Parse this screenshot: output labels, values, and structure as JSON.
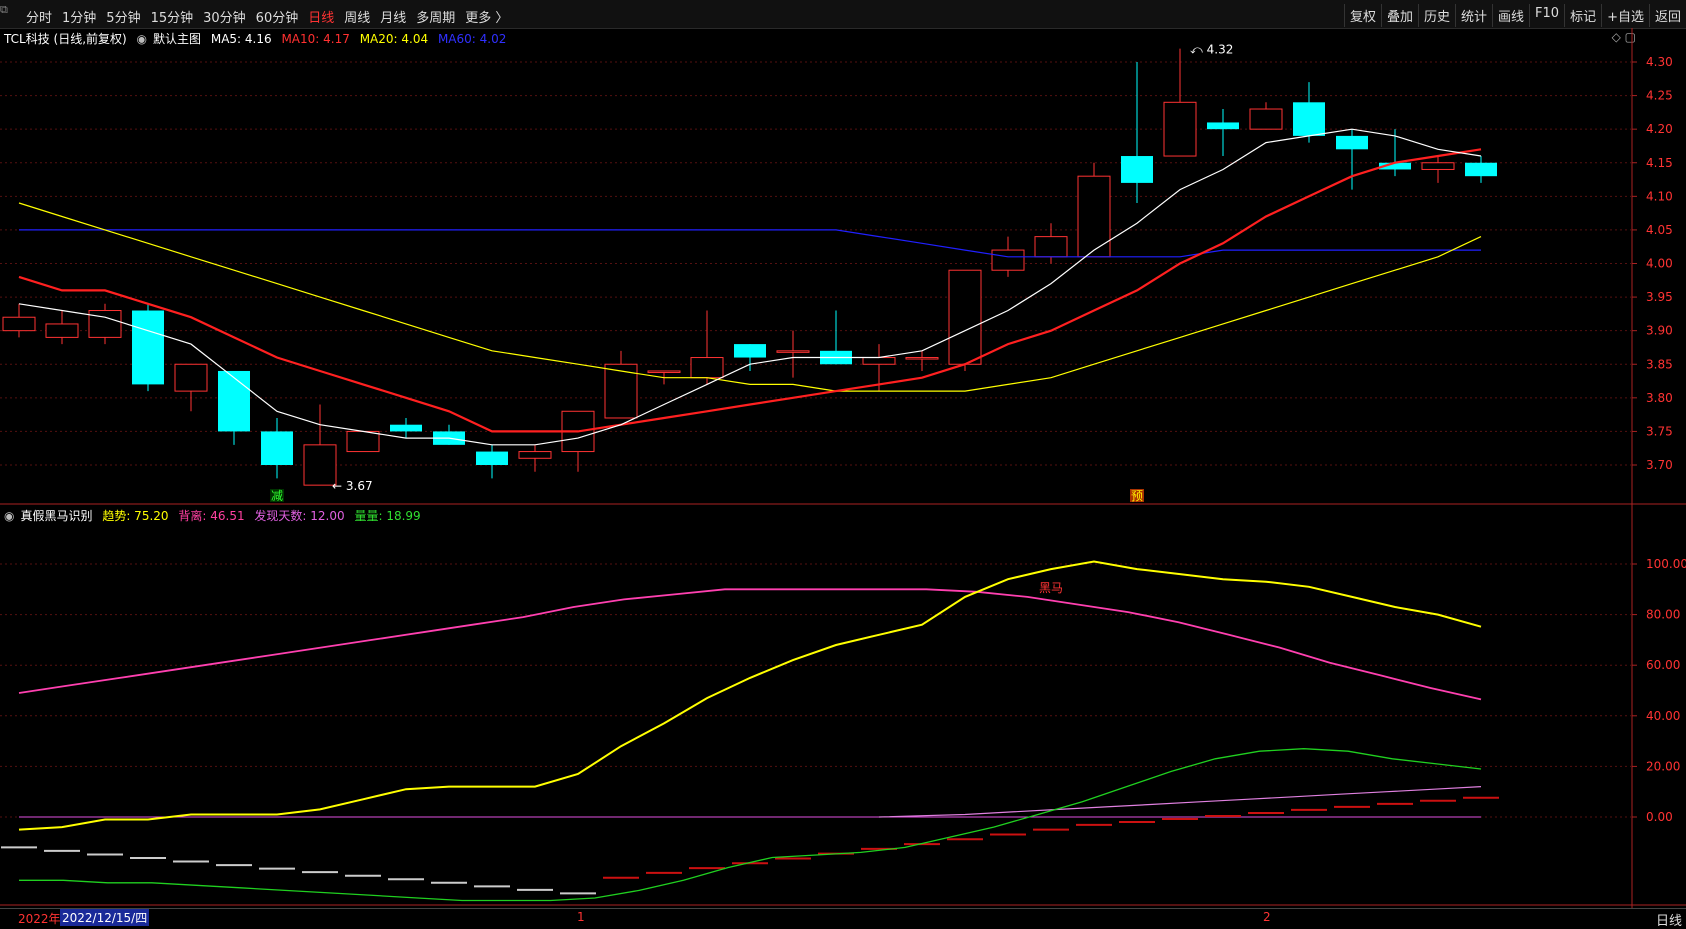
{
  "toolbar": {
    "periods": [
      "分时",
      "1分钟",
      "5分钟",
      "15分钟",
      "30分钟",
      "60分钟",
      "日线",
      "周线",
      "月线",
      "多周期",
      "更多 〉"
    ],
    "active_period": "日线",
    "right_tools": [
      "复权",
      "叠加",
      "历史",
      "统计",
      "画线",
      "F10",
      "标记",
      "+自选",
      "返回"
    ]
  },
  "main_panel": {
    "title": "TCL科技 (日线,前复权)",
    "indicator_name": "默认主图",
    "ma5_label": "MA5: 4.16",
    "ma10_label": "MA10: 4.17",
    "ma20_label": "MA20: 4.04",
    "ma60_label": "MA60: 4.02",
    "high_label": "4.32",
    "low_label": "3.67",
    "signal_jian": "减",
    "signal_yu": "预",
    "y_ticks": [
      "4.30",
      "4.25",
      "4.20",
      "4.15",
      "4.10",
      "4.05",
      "4.00",
      "3.95",
      "3.90",
      "3.85",
      "3.80",
      "3.75",
      "3.70"
    ],
    "colors": {
      "up": "#ff3333",
      "down": "#00ffff",
      "ma5": "#ffffff",
      "ma10": "#ff2020",
      "ma20": "#ffff00",
      "ma60": "#2020ff"
    }
  },
  "sub_panel": {
    "indicator_name": "真假黑马识别",
    "trend_label": "趋势: 75.20",
    "deviation_label": "背离: 46.51",
    "days_label": "发现天数: 12.00",
    "volume_label": "量量: 18.99",
    "heima_label": "黑马",
    "y_ticks": [
      "100.00",
      "80.00",
      "60.00",
      "40.00",
      "20.00",
      "0.00"
    ]
  },
  "chart_data": {
    "type": "candlestick",
    "candles": [
      {
        "o": 3.9,
        "h": 3.94,
        "l": 3.89,
        "c": 3.92
      },
      {
        "o": 3.89,
        "h": 3.93,
        "l": 3.88,
        "c": 3.91
      },
      {
        "o": 3.89,
        "h": 3.94,
        "l": 3.88,
        "c": 3.93
      },
      {
        "o": 3.93,
        "h": 3.94,
        "l": 3.81,
        "c": 3.82
      },
      {
        "o": 3.81,
        "h": 3.85,
        "l": 3.78,
        "c": 3.85
      },
      {
        "o": 3.84,
        "h": 3.84,
        "l": 3.73,
        "c": 3.75
      },
      {
        "o": 3.75,
        "h": 3.77,
        "l": 3.68,
        "c": 3.7
      },
      {
        "o": 3.67,
        "h": 3.79,
        "l": 3.67,
        "c": 3.73
      },
      {
        "o": 3.72,
        "h": 3.75,
        "l": 3.72,
        "c": 3.75
      },
      {
        "o": 3.76,
        "h": 3.77,
        "l": 3.74,
        "c": 3.75
      },
      {
        "o": 3.75,
        "h": 3.76,
        "l": 3.73,
        "c": 3.73
      },
      {
        "o": 3.72,
        "h": 3.73,
        "l": 3.68,
        "c": 3.7
      },
      {
        "o": 3.71,
        "h": 3.73,
        "l": 3.69,
        "c": 3.72
      },
      {
        "o": 3.72,
        "h": 3.78,
        "l": 3.69,
        "c": 3.78
      },
      {
        "o": 3.77,
        "h": 3.87,
        "l": 3.77,
        "c": 3.85
      },
      {
        "o": 3.84,
        "h": 3.84,
        "l": 3.82,
        "c": 3.84
      },
      {
        "o": 3.83,
        "h": 3.93,
        "l": 3.82,
        "c": 3.86
      },
      {
        "o": 3.88,
        "h": 3.88,
        "l": 3.84,
        "c": 3.86
      },
      {
        "o": 3.87,
        "h": 3.9,
        "l": 3.83,
        "c": 3.87
      },
      {
        "o": 3.87,
        "h": 3.93,
        "l": 3.85,
        "c": 3.85
      },
      {
        "o": 3.85,
        "h": 3.88,
        "l": 3.81,
        "c": 3.86
      },
      {
        "o": 3.86,
        "h": 3.87,
        "l": 3.84,
        "c": 3.86
      },
      {
        "o": 3.85,
        "h": 3.99,
        "l": 3.84,
        "c": 3.99
      },
      {
        "o": 3.99,
        "h": 4.04,
        "l": 3.98,
        "c": 4.02
      },
      {
        "o": 4.01,
        "h": 4.06,
        "l": 4.0,
        "c": 4.04
      },
      {
        "o": 4.01,
        "h": 4.15,
        "l": 4.01,
        "c": 4.13
      },
      {
        "o": 4.16,
        "h": 4.3,
        "l": 4.09,
        "c": 4.12
      },
      {
        "o": 4.16,
        "h": 4.32,
        "l": 4.16,
        "c": 4.24
      },
      {
        "o": 4.21,
        "h": 4.23,
        "l": 4.16,
        "c": 4.2
      },
      {
        "o": 4.2,
        "h": 4.24,
        "l": 4.2,
        "c": 4.23
      },
      {
        "o": 4.24,
        "h": 4.27,
        "l": 4.18,
        "c": 4.19
      },
      {
        "o": 4.19,
        "h": 4.2,
        "l": 4.11,
        "c": 4.17
      },
      {
        "o": 4.15,
        "h": 4.2,
        "l": 4.13,
        "c": 4.14
      },
      {
        "o": 4.14,
        "h": 4.16,
        "l": 4.12,
        "c": 4.15
      },
      {
        "o": 4.15,
        "h": 4.16,
        "l": 4.12,
        "c": 4.13
      }
    ],
    "ma5": [
      3.94,
      3.93,
      3.92,
      3.9,
      3.88,
      3.83,
      3.78,
      3.76,
      3.75,
      3.74,
      3.74,
      3.73,
      3.73,
      3.74,
      3.76,
      3.79,
      3.82,
      3.85,
      3.86,
      3.86,
      3.86,
      3.87,
      3.9,
      3.93,
      3.97,
      4.02,
      4.06,
      4.11,
      4.14,
      4.18,
      4.19,
      4.2,
      4.19,
      4.17,
      4.16
    ],
    "ma10": [
      3.98,
      3.96,
      3.96,
      3.94,
      3.92,
      3.89,
      3.86,
      3.84,
      3.82,
      3.8,
      3.78,
      3.75,
      3.75,
      3.75,
      3.76,
      3.77,
      3.78,
      3.79,
      3.8,
      3.81,
      3.82,
      3.83,
      3.85,
      3.88,
      3.9,
      3.93,
      3.96,
      4.0,
      4.03,
      4.07,
      4.1,
      4.13,
      4.15,
      4.16,
      4.17
    ],
    "ma20": [
      4.09,
      4.07,
      4.05,
      4.03,
      4.01,
      3.99,
      3.97,
      3.95,
      3.93,
      3.91,
      3.89,
      3.87,
      3.86,
      3.85,
      3.84,
      3.83,
      3.83,
      3.82,
      3.82,
      3.81,
      3.81,
      3.81,
      3.81,
      3.82,
      3.83,
      3.85,
      3.87,
      3.89,
      3.91,
      3.93,
      3.95,
      3.97,
      3.99,
      4.01,
      4.04
    ],
    "ma60": [
      4.05,
      4.05,
      4.05,
      4.05,
      4.05,
      4.05,
      4.05,
      4.05,
      4.05,
      4.05,
      4.05,
      4.05,
      4.05,
      4.05,
      4.05,
      4.05,
      4.05,
      4.05,
      4.05,
      4.05,
      4.04,
      4.03,
      4.02,
      4.01,
      4.01,
      4.01,
      4.01,
      4.01,
      4.02,
      4.02,
      4.02,
      4.02,
      4.02,
      4.02,
      4.02
    ],
    "ylim": [
      3.66,
      4.33
    ],
    "sub_series": {
      "trend": [
        -5,
        -4,
        -1,
        -1,
        1,
        1,
        1,
        3,
        7,
        11,
        12,
        12,
        12,
        17,
        28,
        37,
        47,
        55,
        62,
        68,
        72,
        76,
        87,
        94,
        98,
        101,
        98,
        96,
        94,
        93,
        91,
        87,
        83,
        80,
        75.2
      ],
      "deviation": [
        49,
        52,
        55,
        58,
        61,
        64,
        67,
        70,
        73,
        76,
        79,
        83,
        86,
        88,
        90,
        90,
        90,
        90,
        90,
        89,
        87,
        84,
        81,
        77,
        72,
        67,
        61,
        56,
        51,
        46.5
      ],
      "volume": [
        -25,
        -25,
        -26,
        -26,
        -27,
        -28,
        -29,
        -30,
        -31,
        -32,
        -33,
        -33,
        -33,
        -32,
        -29,
        -25,
        -20,
        -16,
        -15,
        -14,
        -12,
        -8,
        -4,
        1,
        6,
        12,
        18,
        23,
        26,
        27,
        26,
        23,
        21,
        18.99
      ],
      "days": [
        0,
        0,
        0,
        0,
        0,
        0,
        0,
        0,
        0,
        0,
        0,
        0,
        0,
        0,
        0,
        0,
        0,
        0,
        0,
        0,
        0,
        0,
        1,
        2,
        3,
        4,
        5,
        6,
        7,
        8,
        9,
        10,
        11,
        12
      ],
      "sub_ylim": [
        -35,
        115
      ]
    }
  },
  "x_axis": {
    "year_label": "2022年",
    "date_label": "2022/12/15/四",
    "month1_label": "1",
    "month2_label": "2",
    "timeframe": "日线"
  }
}
